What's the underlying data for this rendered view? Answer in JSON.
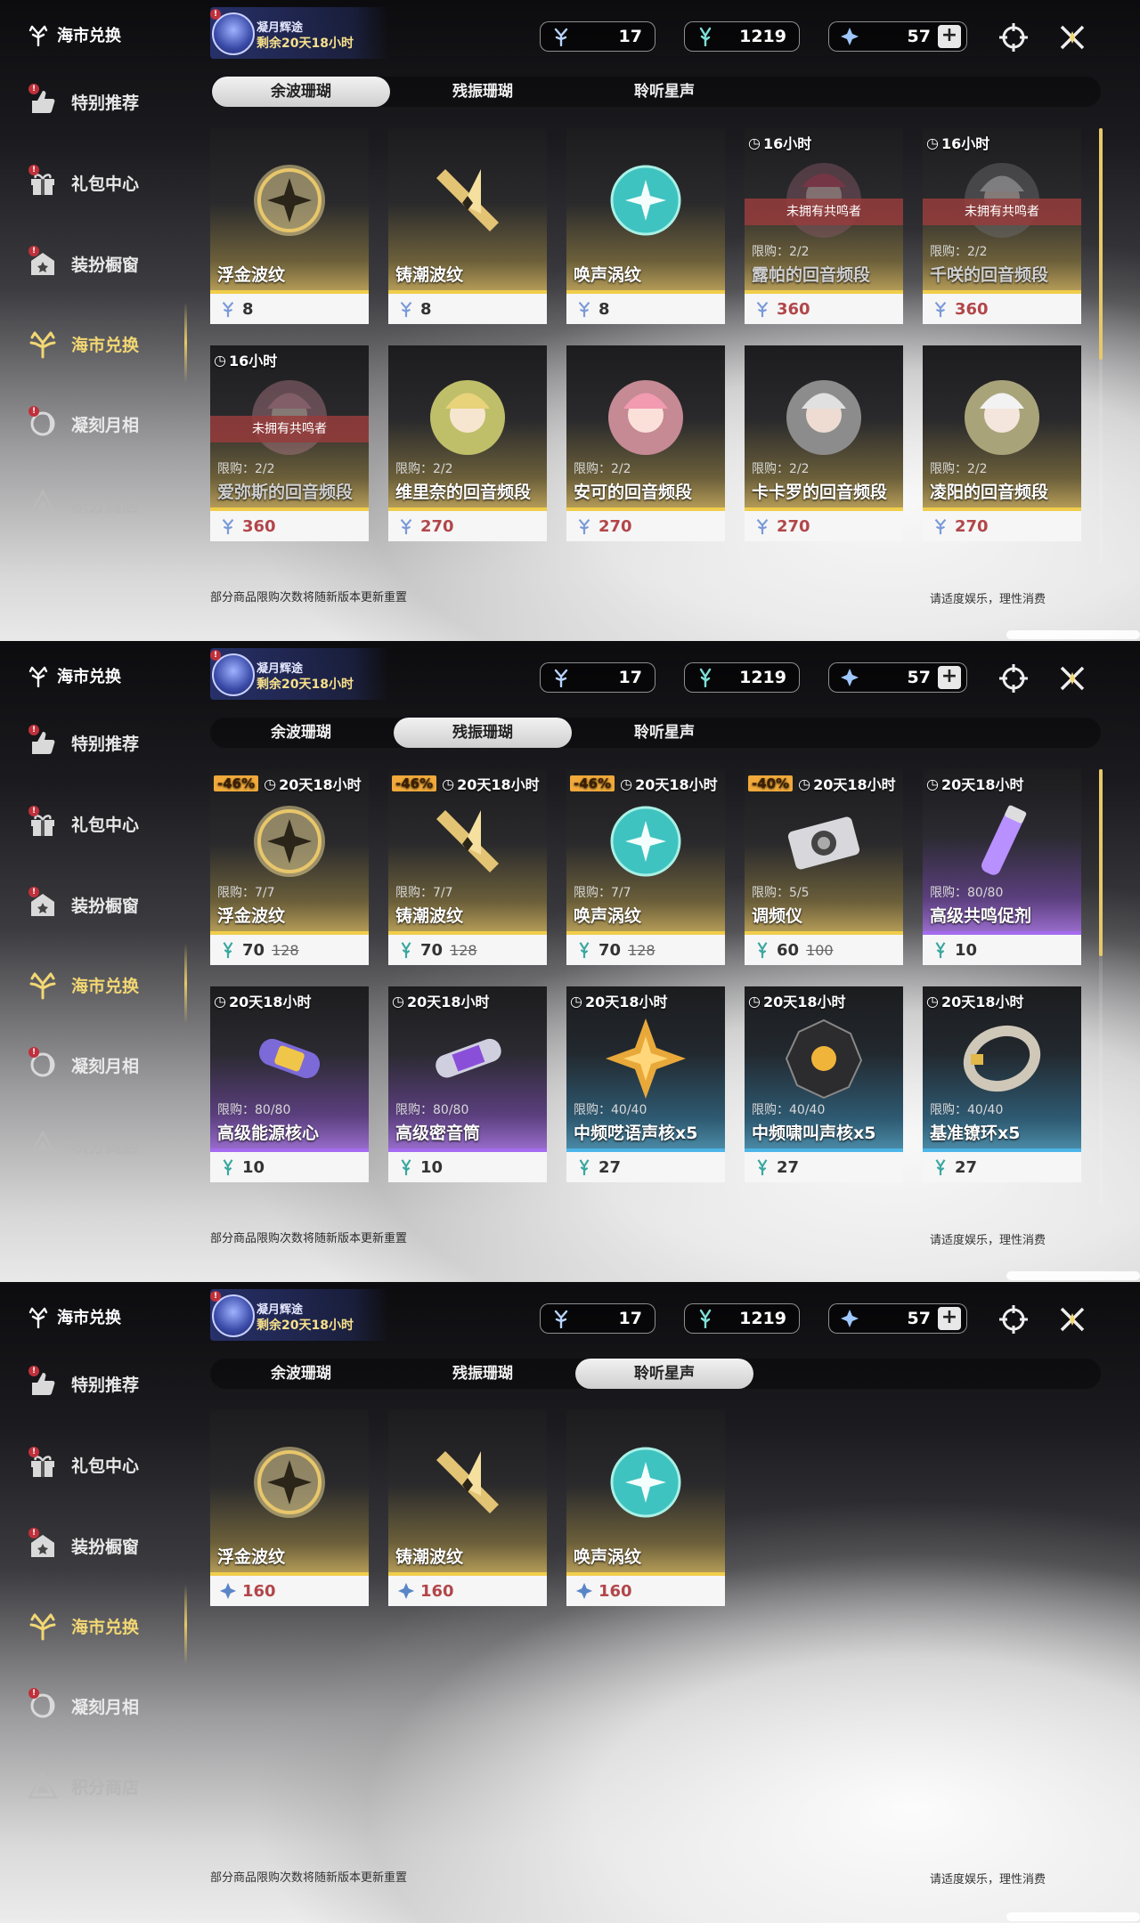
{
  "sidebar": {
    "header": "海市兑换",
    "items": [
      {
        "label": "特别推荐"
      },
      {
        "label": "礼包中心"
      },
      {
        "label": "装扮橱窗"
      },
      {
        "label": "海市兑换"
      },
      {
        "label": "凝刻月相"
      },
      {
        "label": "积分商店"
      }
    ]
  },
  "event": {
    "title": "凝月辉途",
    "subtitle": "剩余20天18小时"
  },
  "currency": {
    "a": "17",
    "b": "1219",
    "c": "57",
    "plus": "+"
  },
  "tabs": [
    "余波珊瑚",
    "残振珊瑚",
    "聆听星声"
  ],
  "no_owner": "未拥有共鸣者",
  "footer": {
    "left": "部分商品限购次数将随新版本更新重置",
    "right": "请适度娱乐，理性消费"
  },
  "panel1": {
    "cards": [
      {
        "name": "浮金波纹",
        "price": "8",
        "limit": "",
        "timer": "",
        "discount": "",
        "old": ""
      },
      {
        "name": "铸潮波纹",
        "price": "8",
        "limit": "",
        "timer": "",
        "discount": "",
        "old": ""
      },
      {
        "name": "唤声涡纹",
        "price": "8",
        "limit": "",
        "timer": "",
        "discount": "",
        "old": ""
      },
      {
        "name": "露帕的回音频段",
        "price": "360",
        "limit": "限购：2/2",
        "timer": "16小时",
        "discount": "",
        "old": ""
      },
      {
        "name": "千咲的回音频段",
        "price": "360",
        "limit": "限购：2/2",
        "timer": "16小时",
        "discount": "",
        "old": ""
      },
      {
        "name": "爱弥斯的回音频段",
        "price": "360",
        "limit": "限购：2/2",
        "timer": "16小时",
        "discount": "",
        "old": ""
      },
      {
        "name": "维里奈的回音频段",
        "price": "270",
        "limit": "限购：2/2",
        "timer": "",
        "discount": "",
        "old": ""
      },
      {
        "name": "安可的回音频段",
        "price": "270",
        "limit": "限购：2/2",
        "timer": "",
        "discount": "",
        "old": ""
      },
      {
        "name": "卡卡罗的回音频段",
        "price": "270",
        "limit": "限购：2/2",
        "timer": "",
        "discount": "",
        "old": ""
      },
      {
        "name": "凌阳的回音频段",
        "price": "270",
        "limit": "限购：2/2",
        "timer": "",
        "discount": "",
        "old": ""
      }
    ]
  },
  "panel2": {
    "cards": [
      {
        "name": "浮金波纹",
        "price": "70",
        "old": "128",
        "limit": "限购：7/7",
        "timer": "20天18小时",
        "discount": "-46%"
      },
      {
        "name": "铸潮波纹",
        "price": "70",
        "old": "128",
        "limit": "限购：7/7",
        "timer": "20天18小时",
        "discount": "-46%"
      },
      {
        "name": "唤声涡纹",
        "price": "70",
        "old": "128",
        "limit": "限购：7/7",
        "timer": "20天18小时",
        "discount": "-46%"
      },
      {
        "name": "调频仪",
        "price": "60",
        "old": "100",
        "limit": "限购：5/5",
        "timer": "20天18小时",
        "discount": "-40%"
      },
      {
        "name": "高级共鸣促剂",
        "price": "10",
        "old": "",
        "limit": "限购：80/80",
        "timer": "20天18小时",
        "discount": ""
      },
      {
        "name": "高级能源核心",
        "price": "10",
        "old": "",
        "limit": "限购：80/80",
        "timer": "20天18小时",
        "discount": ""
      },
      {
        "name": "高级密音筒",
        "price": "10",
        "old": "",
        "limit": "限购：80/80",
        "timer": "20天18小时",
        "discount": ""
      },
      {
        "name": "中频呓语声核x5",
        "price": "27",
        "old": "",
        "limit": "限购：40/40",
        "timer": "20天18小时",
        "discount": ""
      },
      {
        "name": "中频啸叫声核x5",
        "price": "27",
        "old": "",
        "limit": "限购：40/40",
        "timer": "20天18小时",
        "discount": ""
      },
      {
        "name": "基准镣环x5",
        "price": "27",
        "old": "",
        "limit": "限购：40/40",
        "timer": "20天18小时",
        "discount": ""
      }
    ]
  },
  "panel3": {
    "cards": [
      {
        "name": "浮金波纹",
        "price": "160",
        "limit": "",
        "timer": "",
        "discount": "",
        "old": ""
      },
      {
        "name": "铸潮波纹",
        "price": "160",
        "limit": "",
        "timer": "",
        "discount": "",
        "old": ""
      },
      {
        "name": "唤声涡纹",
        "price": "160",
        "limit": "",
        "timer": "",
        "discount": "",
        "old": ""
      }
    ]
  },
  "colors": {
    "accent": "#f2d773",
    "gold_bar": "#f0cd4b",
    "purple_bar": "#a46bf0",
    "blue_bar": "#4db4e8",
    "discount": "#f0a93a",
    "price_red": "#b2464a"
  }
}
